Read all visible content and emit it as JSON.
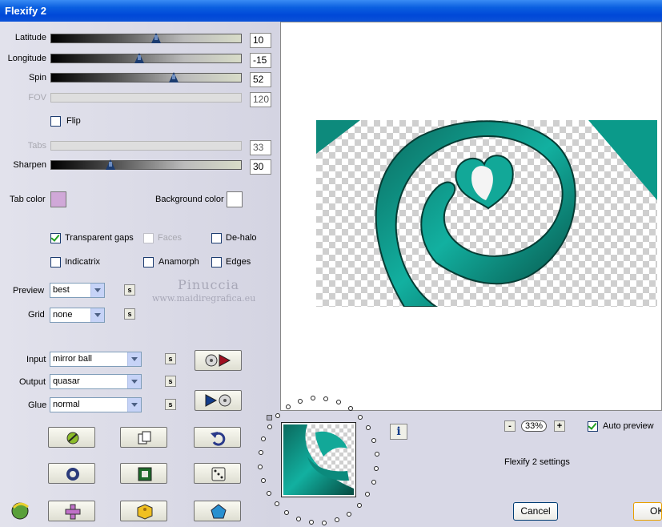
{
  "window": {
    "title": "Flexify 2"
  },
  "sliders": [
    {
      "label": "Latitude",
      "value": "10",
      "level": 0.55,
      "enabled": true
    },
    {
      "label": "Longitude",
      "value": "-15",
      "level": 0.46,
      "enabled": true
    },
    {
      "label": "Spin",
      "value": "52",
      "level": 0.64,
      "enabled": true
    },
    {
      "label": "FOV",
      "value": "120",
      "level": null,
      "enabled": false
    },
    {
      "label": "Tabs",
      "value": "33",
      "level": null,
      "enabled": false
    },
    {
      "label": "Sharpen",
      "value": "30",
      "level": 0.31,
      "enabled": true
    }
  ],
  "flip": {
    "label": "Flip",
    "checked": false
  },
  "colors": {
    "tab_color_label": "Tab color",
    "tab_color": "#d0a8d8",
    "background_color_label": "Background color",
    "background_color": "#ffffff"
  },
  "options": {
    "transparent_gaps": {
      "label": "Transparent gaps",
      "checked": true
    },
    "faces": {
      "label": "Faces",
      "checked": false,
      "enabled": false
    },
    "de_halo": {
      "label": "De-halo",
      "checked": false
    },
    "indicatrix": {
      "label": "Indicatrix",
      "checked": false
    },
    "anamorph": {
      "label": "Anamorph",
      "checked": false
    },
    "edges": {
      "label": "Edges",
      "checked": false
    }
  },
  "preview_select": {
    "label": "Preview",
    "value": "best",
    "s": "s"
  },
  "grid_select": {
    "label": "Grid",
    "value": "none",
    "s": "s"
  },
  "input_select": {
    "label": "Input",
    "value": "mirror ball",
    "s": "s"
  },
  "output_select": {
    "label": "Output",
    "value": "quasar",
    "s": "s"
  },
  "glue_select": {
    "label": "Glue",
    "value": "normal",
    "s": "s"
  },
  "watermark": {
    "name": "Pinuccia",
    "url": "www.maidiregrafica.eu"
  },
  "zoom": {
    "minus": "-",
    "value": "33%",
    "plus": "+"
  },
  "auto_preview": {
    "label": "Auto preview",
    "checked": true
  },
  "settings_label": "Flexify 2 settings",
  "info_icon": "i",
  "buttons": {
    "cancel": "Cancel",
    "ok": "OK"
  },
  "accent": "#0a5fe0",
  "teal": "#0a8a80"
}
